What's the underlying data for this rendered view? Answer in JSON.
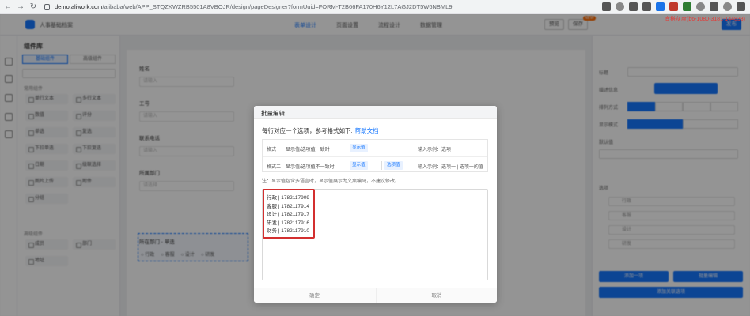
{
  "browser": {
    "url_domain": "demo.aliwork.com",
    "url_path": "/alibaba/web/APP_STQZKWZRB5501A8VBOJR/design/pageDesigner?formUuid=FORM-T2B66FA170H6Y12L7AGJ2DT5W6NBML9",
    "user_info": "宜搭灰度(b6-1080-3181-144833)"
  },
  "app": {
    "crumb": "人事基础档案",
    "tabs": [
      "表单设计",
      "页面设置",
      "流程设计",
      "数据管理"
    ],
    "buttons": [
      "预览",
      "保存",
      "发布"
    ],
    "hot_badge": "NEW",
    "panel_title": "组件库",
    "panel_tabs": [
      "基础组件",
      "高级组件"
    ],
    "groups": [
      "常用组件",
      "高级组件"
    ],
    "components": [
      "单行文本",
      "多行文本",
      "数值",
      "评分",
      "单选",
      "复选",
      "下拉单选",
      "下拉复选",
      "日期",
      "级联选择",
      "图片上传",
      "附件",
      "分组",
      "成员",
      "部门",
      "地址"
    ],
    "canvas_fields": [
      {
        "label": "姓名",
        "placeholder": "请输入"
      },
      {
        "label": "工号",
        "placeholder": "请输入"
      },
      {
        "label": "联系电话",
        "placeholder": "请输入"
      },
      {
        "label": "所属部门",
        "placeholder": "请选择"
      }
    ],
    "selected_field": "所在部门 - 单选",
    "radio_options": [
      "行政",
      "客服",
      "设计",
      "研发"
    ],
    "right_labels": [
      "标题",
      "描述信息",
      "排列方式",
      "显示模式",
      "默认值",
      "选项"
    ],
    "right_buttons": [
      "添加一项",
      "批量编辑",
      "添加关联选项"
    ]
  },
  "modal": {
    "title": "批量编辑",
    "desc": "每行对应一个选项，参考格式如下:",
    "help": "帮助文档",
    "formats": [
      {
        "label": "格式一：显示值/选项值一致时",
        "tags": [
          "显示值"
        ],
        "example": "输入示例：选项一"
      },
      {
        "label": "格式二：显示值/选项值不一致时",
        "tags": [
          "显示值",
          "选项值"
        ],
        "example": "输入示例：选项一 | 选项一的值"
      }
    ],
    "note": "注：显示值包含多语言时，显示值展示为文案编码，不建议修改。",
    "lines": [
      "行政 | 1782117909",
      "客服 | 1782117914",
      "设计 | 1782117917",
      "研发 | 1782117916",
      "财务 | 1782117910"
    ],
    "ok": "确定",
    "cancel": "取消"
  }
}
